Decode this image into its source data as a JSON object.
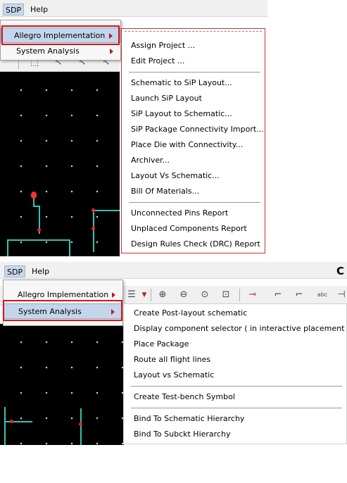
{
  "menubar": {
    "sdp_label": "SDP",
    "help_label": "Help"
  },
  "sdp_menu": {
    "allegro_label": "Allegro Implementation",
    "system_label": "System Analysis"
  },
  "allegro_submenu": {
    "items": [
      "Assign Project ...",
      "Edit Project ...",
      "Schematic to SiP Layout...",
      "Launch SiP Layout",
      "SiP Layout to Schematic...",
      "SiP Package Connectivity Import...",
      "Place Die with Connectivity...",
      "Archiver...",
      "Layout Vs Schematic...",
      "Bill Of Materials...",
      "Unconnected Pins Report",
      "Unplaced Components Report",
      "Design Rules Check (DRC) Report"
    ]
  },
  "system_submenu": {
    "items": [
      "Create Post-layout schematic",
      "Display component selector ( in interactive placement )",
      "Place Package",
      "Route all flight lines",
      "Layout vs Schematic",
      "Create Test-bench Symbol",
      "Bind To Schematic Hierarchy",
      "Bind To Subckt Hierarchy"
    ]
  },
  "toolbar2": {
    "abc_label": "abc",
    "corner_letter": "C"
  },
  "colors": {
    "highlight_box": "#e01010",
    "menu_hover": "#c4d6ec",
    "canvas": "#000000",
    "wire": "#36c3b0"
  },
  "icons": [
    "zoom-in-icon",
    "zoom-out-icon",
    "zoom-fit-icon",
    "zoom-area-icon",
    "submenu-arrow-icon"
  ]
}
